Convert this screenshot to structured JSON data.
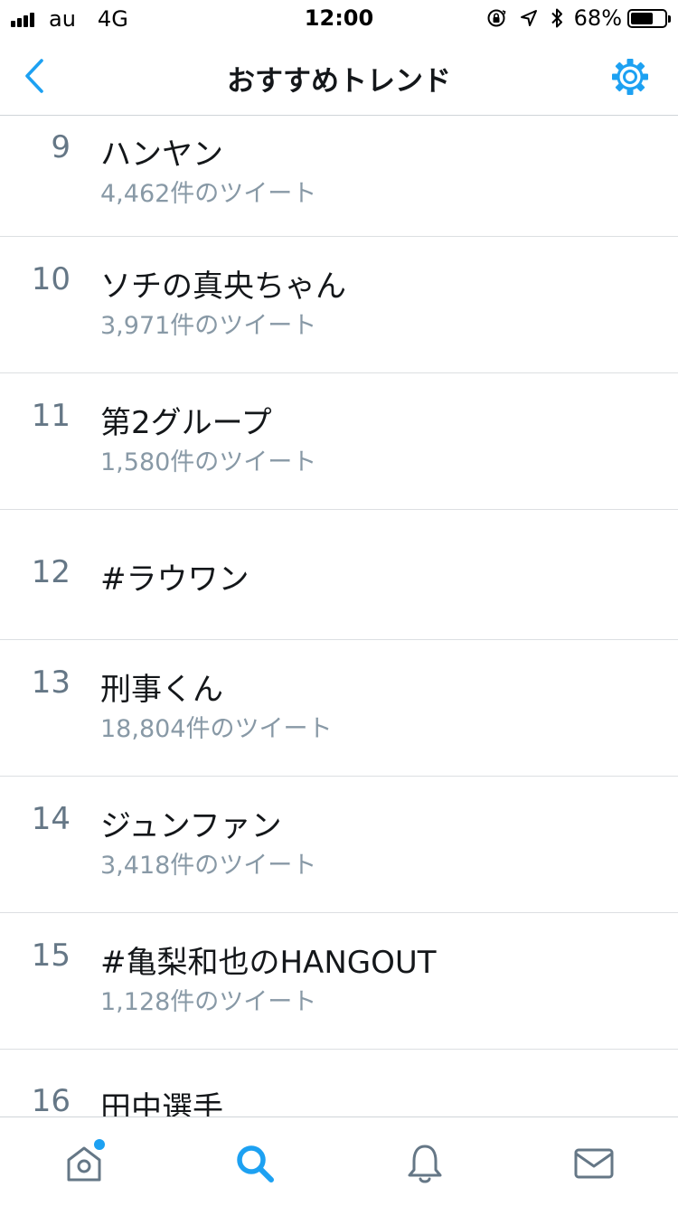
{
  "status_bar": {
    "carrier": "au",
    "network": "4G",
    "time": "12:00",
    "battery_percent": "68%",
    "battery_level": 0.68
  },
  "nav": {
    "title": "おすすめトレンド"
  },
  "trends": [
    {
      "rank": "9",
      "name": "ハンヤン",
      "count": "4,462件のツイート"
    },
    {
      "rank": "10",
      "name": "ソチの真央ちゃん",
      "count": "3,971件のツイート"
    },
    {
      "rank": "11",
      "name": "第2グループ",
      "count": "1,580件のツイート"
    },
    {
      "rank": "12",
      "name": "#ラウワン",
      "count": ""
    },
    {
      "rank": "13",
      "name": "刑事くん",
      "count": "18,804件のツイート"
    },
    {
      "rank": "14",
      "name": "ジュンファン",
      "count": "3,418件のツイート"
    },
    {
      "rank": "15",
      "name": "#亀梨和也のHANGOUT",
      "count": "1,128件のツイート"
    },
    {
      "rank": "16",
      "name": "田中選手",
      "count": ""
    }
  ],
  "tab_bar": {
    "items": [
      "home-icon",
      "search-icon",
      "notifications-icon",
      "messages-icon"
    ],
    "active": "search-icon",
    "home_has_badge": true
  },
  "colors": {
    "accent": "#1da1f2",
    "text_primary": "#14171a",
    "text_secondary": "#8899a6",
    "rank": "#657786",
    "tab_inactive": "#657786"
  }
}
